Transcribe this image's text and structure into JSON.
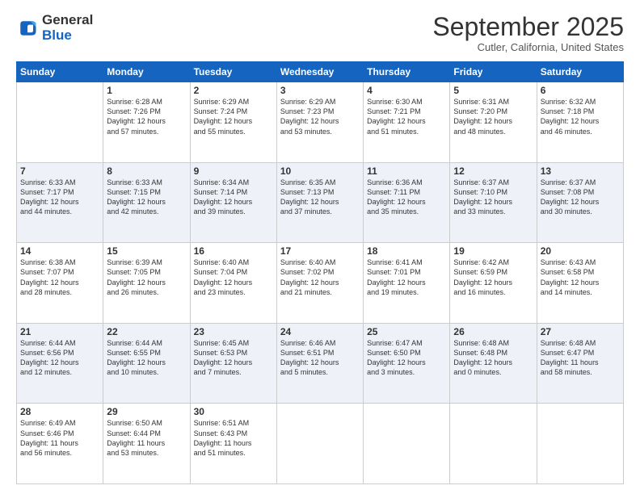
{
  "logo": {
    "general": "General",
    "blue": "Blue"
  },
  "title": "September 2025",
  "subtitle": "Cutler, California, United States",
  "weekdays": [
    "Sunday",
    "Monday",
    "Tuesday",
    "Wednesday",
    "Thursday",
    "Friday",
    "Saturday"
  ],
  "weeks": [
    [
      {
        "day": "",
        "info": ""
      },
      {
        "day": "1",
        "info": "Sunrise: 6:28 AM\nSunset: 7:26 PM\nDaylight: 12 hours\nand 57 minutes."
      },
      {
        "day": "2",
        "info": "Sunrise: 6:29 AM\nSunset: 7:24 PM\nDaylight: 12 hours\nand 55 minutes."
      },
      {
        "day": "3",
        "info": "Sunrise: 6:29 AM\nSunset: 7:23 PM\nDaylight: 12 hours\nand 53 minutes."
      },
      {
        "day": "4",
        "info": "Sunrise: 6:30 AM\nSunset: 7:21 PM\nDaylight: 12 hours\nand 51 minutes."
      },
      {
        "day": "5",
        "info": "Sunrise: 6:31 AM\nSunset: 7:20 PM\nDaylight: 12 hours\nand 48 minutes."
      },
      {
        "day": "6",
        "info": "Sunrise: 6:32 AM\nSunset: 7:18 PM\nDaylight: 12 hours\nand 46 minutes."
      }
    ],
    [
      {
        "day": "7",
        "info": "Sunrise: 6:33 AM\nSunset: 7:17 PM\nDaylight: 12 hours\nand 44 minutes."
      },
      {
        "day": "8",
        "info": "Sunrise: 6:33 AM\nSunset: 7:15 PM\nDaylight: 12 hours\nand 42 minutes."
      },
      {
        "day": "9",
        "info": "Sunrise: 6:34 AM\nSunset: 7:14 PM\nDaylight: 12 hours\nand 39 minutes."
      },
      {
        "day": "10",
        "info": "Sunrise: 6:35 AM\nSunset: 7:13 PM\nDaylight: 12 hours\nand 37 minutes."
      },
      {
        "day": "11",
        "info": "Sunrise: 6:36 AM\nSunset: 7:11 PM\nDaylight: 12 hours\nand 35 minutes."
      },
      {
        "day": "12",
        "info": "Sunrise: 6:37 AM\nSunset: 7:10 PM\nDaylight: 12 hours\nand 33 minutes."
      },
      {
        "day": "13",
        "info": "Sunrise: 6:37 AM\nSunset: 7:08 PM\nDaylight: 12 hours\nand 30 minutes."
      }
    ],
    [
      {
        "day": "14",
        "info": "Sunrise: 6:38 AM\nSunset: 7:07 PM\nDaylight: 12 hours\nand 28 minutes."
      },
      {
        "day": "15",
        "info": "Sunrise: 6:39 AM\nSunset: 7:05 PM\nDaylight: 12 hours\nand 26 minutes."
      },
      {
        "day": "16",
        "info": "Sunrise: 6:40 AM\nSunset: 7:04 PM\nDaylight: 12 hours\nand 23 minutes."
      },
      {
        "day": "17",
        "info": "Sunrise: 6:40 AM\nSunset: 7:02 PM\nDaylight: 12 hours\nand 21 minutes."
      },
      {
        "day": "18",
        "info": "Sunrise: 6:41 AM\nSunset: 7:01 PM\nDaylight: 12 hours\nand 19 minutes."
      },
      {
        "day": "19",
        "info": "Sunrise: 6:42 AM\nSunset: 6:59 PM\nDaylight: 12 hours\nand 16 minutes."
      },
      {
        "day": "20",
        "info": "Sunrise: 6:43 AM\nSunset: 6:58 PM\nDaylight: 12 hours\nand 14 minutes."
      }
    ],
    [
      {
        "day": "21",
        "info": "Sunrise: 6:44 AM\nSunset: 6:56 PM\nDaylight: 12 hours\nand 12 minutes."
      },
      {
        "day": "22",
        "info": "Sunrise: 6:44 AM\nSunset: 6:55 PM\nDaylight: 12 hours\nand 10 minutes."
      },
      {
        "day": "23",
        "info": "Sunrise: 6:45 AM\nSunset: 6:53 PM\nDaylight: 12 hours\nand 7 minutes."
      },
      {
        "day": "24",
        "info": "Sunrise: 6:46 AM\nSunset: 6:51 PM\nDaylight: 12 hours\nand 5 minutes."
      },
      {
        "day": "25",
        "info": "Sunrise: 6:47 AM\nSunset: 6:50 PM\nDaylight: 12 hours\nand 3 minutes."
      },
      {
        "day": "26",
        "info": "Sunrise: 6:48 AM\nSunset: 6:48 PM\nDaylight: 12 hours\nand 0 minutes."
      },
      {
        "day": "27",
        "info": "Sunrise: 6:48 AM\nSunset: 6:47 PM\nDaylight: 11 hours\nand 58 minutes."
      }
    ],
    [
      {
        "day": "28",
        "info": "Sunrise: 6:49 AM\nSunset: 6:46 PM\nDaylight: 11 hours\nand 56 minutes."
      },
      {
        "day": "29",
        "info": "Sunrise: 6:50 AM\nSunset: 6:44 PM\nDaylight: 11 hours\nand 53 minutes."
      },
      {
        "day": "30",
        "info": "Sunrise: 6:51 AM\nSunset: 6:43 PM\nDaylight: 11 hours\nand 51 minutes."
      },
      {
        "day": "",
        "info": ""
      },
      {
        "day": "",
        "info": ""
      },
      {
        "day": "",
        "info": ""
      },
      {
        "day": "",
        "info": ""
      }
    ]
  ]
}
